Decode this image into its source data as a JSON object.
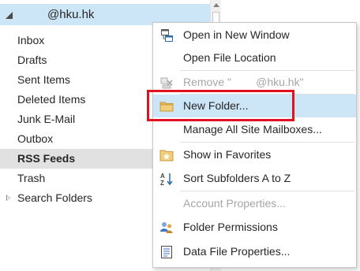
{
  "account": {
    "name": "@hku.hk"
  },
  "folders": [
    {
      "label": "Inbox"
    },
    {
      "label": "Drafts"
    },
    {
      "label": "Sent Items"
    },
    {
      "label": "Deleted Items"
    },
    {
      "label": "Junk E-Mail"
    },
    {
      "label": "Outbox"
    },
    {
      "label": "RSS Feeds",
      "selected": true
    },
    {
      "label": "Trash"
    },
    {
      "label": "Search Folders",
      "collapsed": true
    }
  ],
  "context_menu": {
    "items": [
      {
        "label": "Open in New Window",
        "icon": "new-window-icon"
      },
      {
        "label": "Open File Location",
        "icon": ""
      },
      {
        "label": "Remove \"        @hku.hk\"",
        "icon": "remove-account-icon",
        "disabled": true
      },
      {
        "label": "New Folder...",
        "icon": "folder-icon",
        "highlighted": true
      },
      {
        "label": "Manage All Site Mailboxes...",
        "icon": ""
      },
      {
        "label": "Show in Favorites",
        "icon": "favorite-folder-icon"
      },
      {
        "label": "Sort Subfolders A to Z",
        "icon": "sort-az-icon"
      },
      {
        "label": "Account Properties...",
        "icon": "",
        "disabled": true
      },
      {
        "label": "Folder Permissions",
        "icon": "permissions-icon"
      },
      {
        "label": "Data File Properties...",
        "icon": "properties-icon"
      }
    ]
  },
  "colors": {
    "selection": "#cde6f7",
    "selected_folder": "#e1e1e1",
    "annotation_box": "#e3101e",
    "disabled_text": "#a6a6a6"
  }
}
